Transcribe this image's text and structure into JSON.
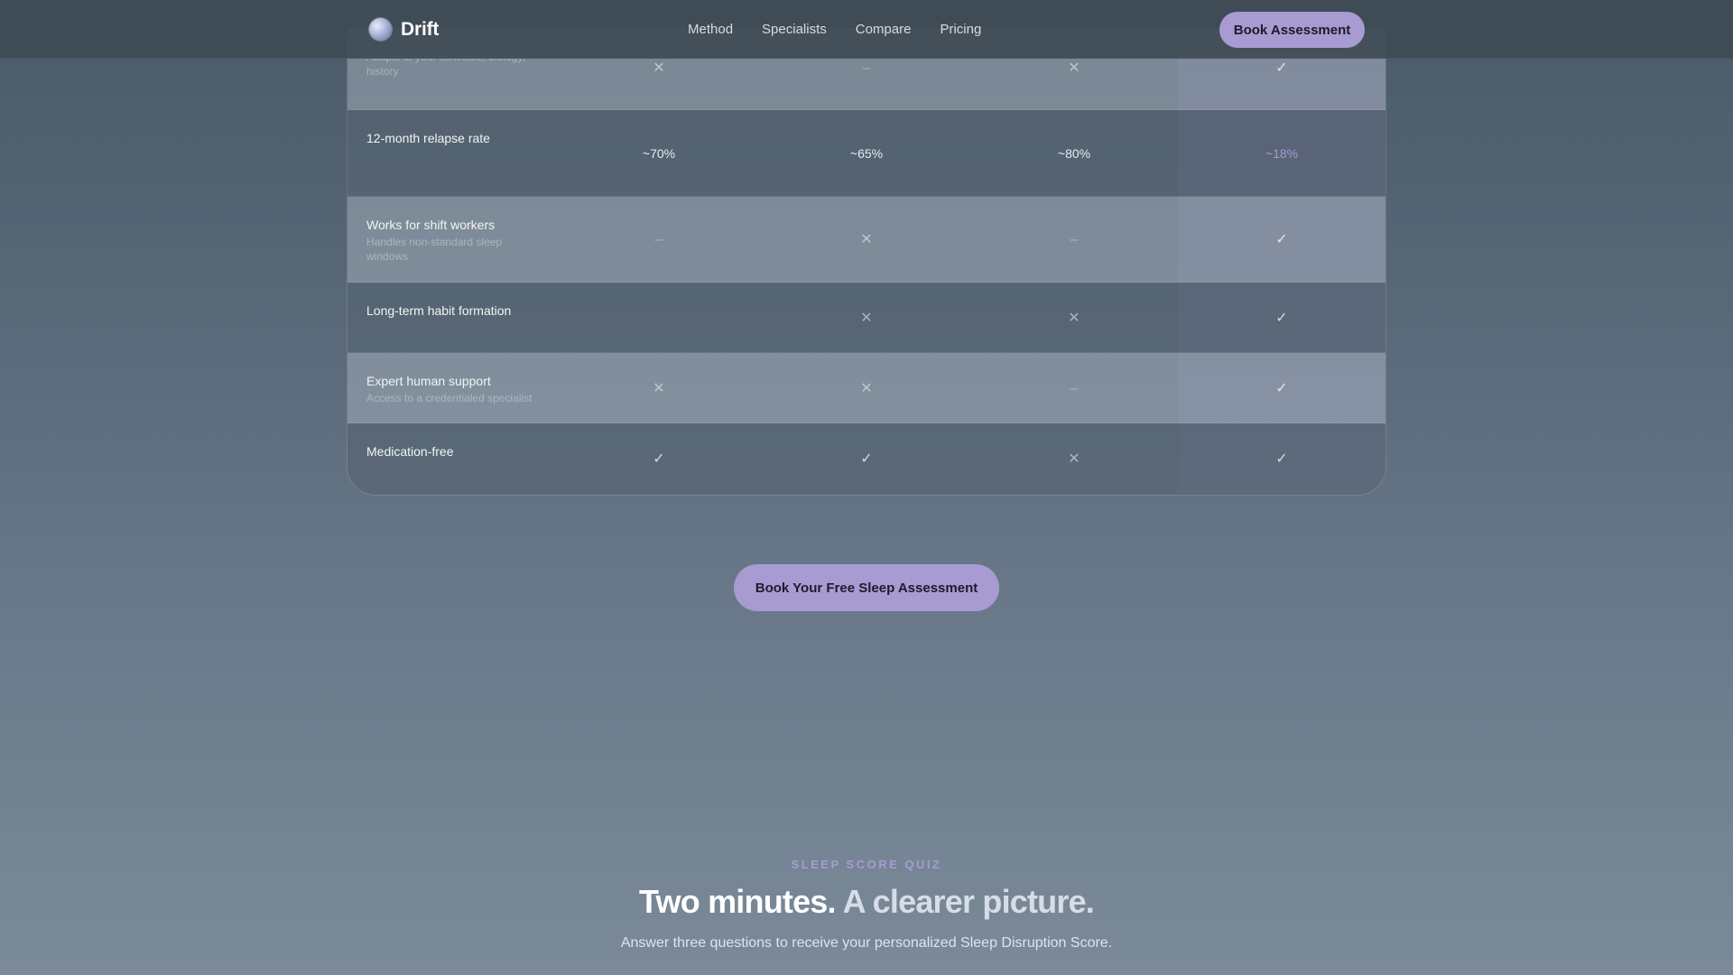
{
  "nav": {
    "brand": "Drift",
    "links": [
      "Method",
      "Specialists",
      "Compare",
      "Pricing"
    ],
    "cta": "Book Assessment"
  },
  "comparison": {
    "rows": [
      {
        "title": "",
        "subtitle": "Adapts to your schedule, biology, history",
        "values": [
          "x",
          "dash",
          "x",
          "check"
        ]
      },
      {
        "title": "12-month relapse rate",
        "subtitle": "",
        "values": [
          "~70%",
          "~65%",
          "~80%",
          "~18%"
        ]
      },
      {
        "title": "Works for shift workers",
        "subtitle": "Handles non-standard sleep windows",
        "values": [
          "dash",
          "x",
          "dash",
          "check"
        ]
      },
      {
        "title": "Long-term habit formation",
        "subtitle": "",
        "values": [
          "",
          "x",
          "x",
          "check"
        ]
      },
      {
        "title": "Expert human support",
        "subtitle": "Access to a credentialed specialist",
        "values": [
          "x",
          "x",
          "dash",
          "check"
        ]
      },
      {
        "title": "Medication-free",
        "subtitle": "",
        "values": [
          "check",
          "check",
          "x",
          "check"
        ]
      }
    ]
  },
  "cta_main": "Book Your Free Sleep Assessment",
  "quiz": {
    "eyebrow": "SLEEP SCORE QUIZ",
    "headline_strong": "Two minutes.",
    "headline_soft": "A clearer picture.",
    "subline": "Answer three questions to receive your personalized Sleep Disruption Score."
  },
  "colors": {
    "accent": "#a79bd2",
    "background_top": "#4b5a69",
    "background_bottom": "#7a8a99"
  },
  "icons": {
    "x": "cross-icon",
    "dash": "dash-icon",
    "check": "check-icon"
  }
}
